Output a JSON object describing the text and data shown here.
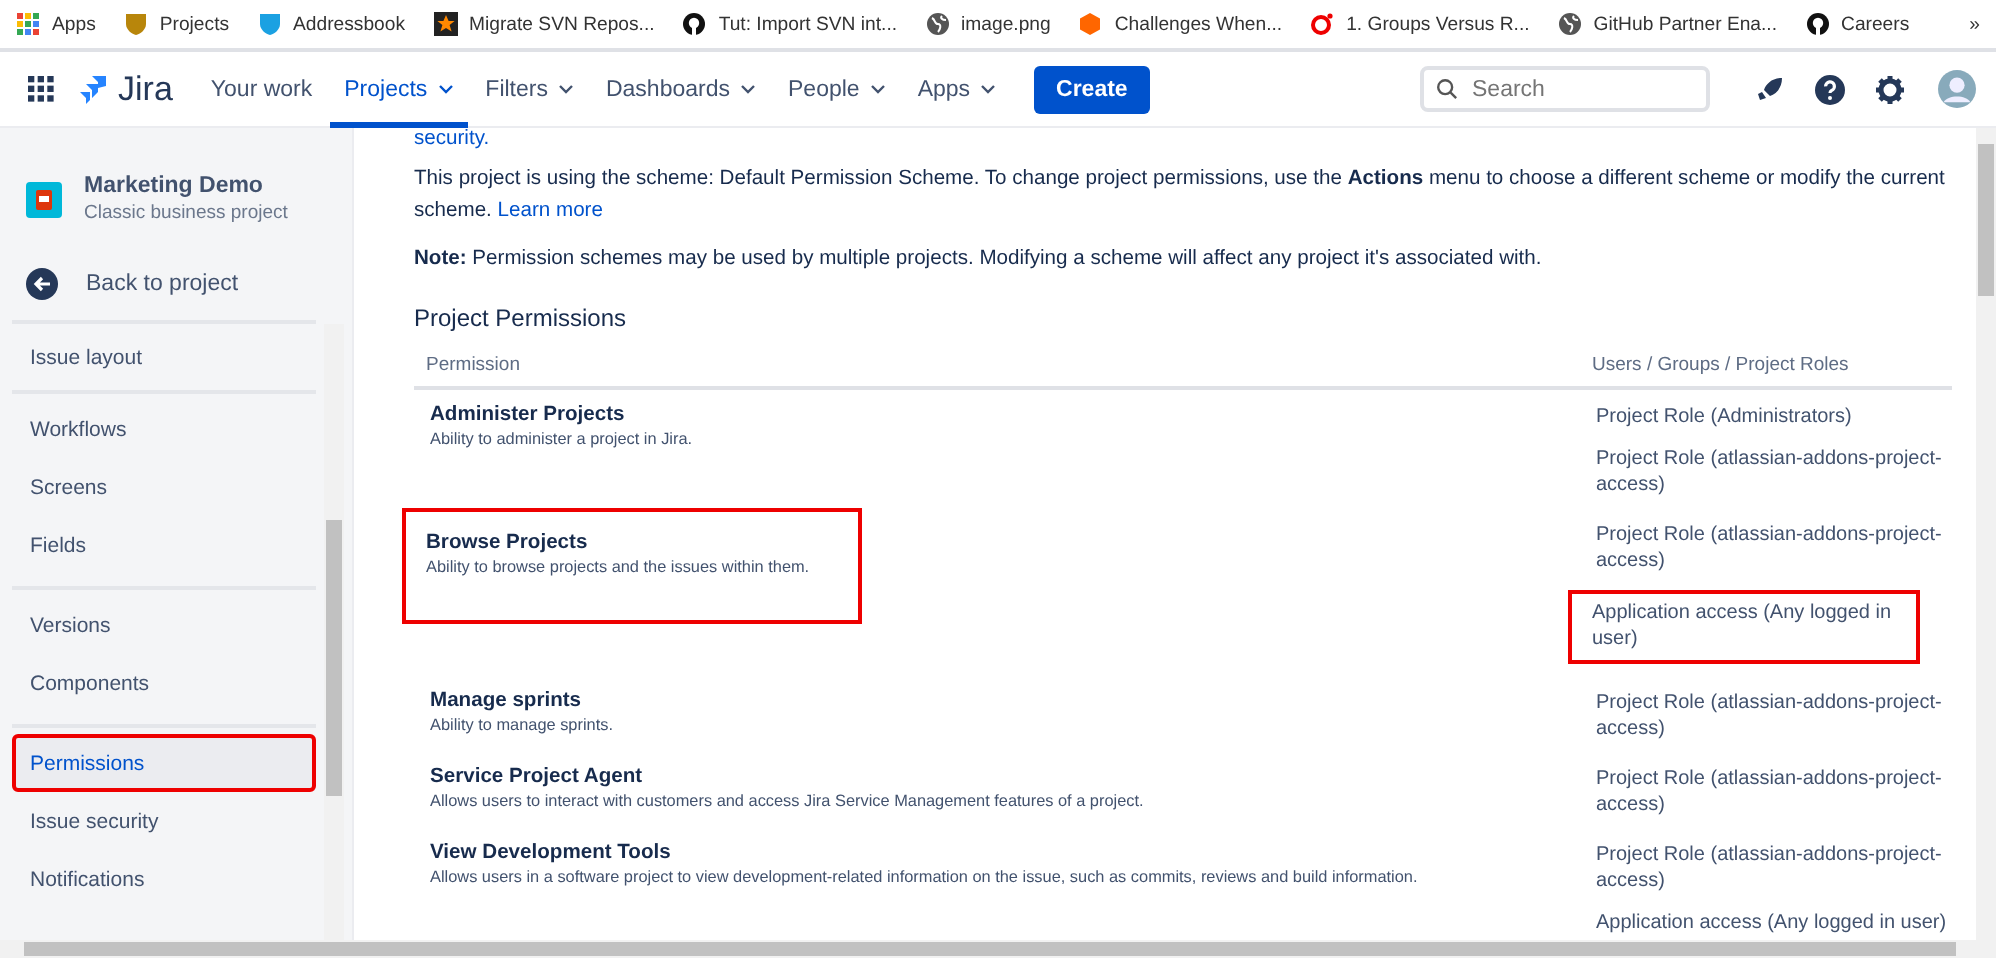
{
  "bookmarks": [
    "Apps",
    "Projects",
    "Addressbook",
    "Migrate SVN Repos...",
    "Tut: Import SVN int...",
    "image.png",
    "Challenges When...",
    "1. Groups Versus R...",
    "GitHub Partner Ena...",
    "Careers"
  ],
  "bookmarks_more": "»",
  "nav": {
    "logo": "Jira",
    "items": [
      {
        "label": "Your work",
        "dropdown": false,
        "selected": false
      },
      {
        "label": "Projects",
        "dropdown": true,
        "selected": true
      },
      {
        "label": "Filters",
        "dropdown": true,
        "selected": false
      },
      {
        "label": "Dashboards",
        "dropdown": true,
        "selected": false
      },
      {
        "label": "People",
        "dropdown": true,
        "selected": false
      },
      {
        "label": "Apps",
        "dropdown": true,
        "selected": false
      }
    ],
    "create": "Create",
    "search": {
      "placeholder": "Search"
    }
  },
  "sidebar": {
    "project": {
      "name": "Marketing Demo",
      "type": "Classic business project"
    },
    "back": "Back to project",
    "sections": [
      {
        "items": [
          {
            "label": "Issue layout",
            "selected": false,
            "highlighted": false
          }
        ]
      },
      {
        "items": [
          {
            "label": "Workflows",
            "selected": false,
            "highlighted": false
          },
          {
            "label": "Screens",
            "selected": false,
            "highlighted": false
          },
          {
            "label": "Fields",
            "selected": false,
            "highlighted": false
          }
        ]
      },
      {
        "items": [
          {
            "label": "Versions",
            "selected": false,
            "highlighted": false
          },
          {
            "label": "Components",
            "selected": false,
            "highlighted": false
          }
        ]
      },
      {
        "items": [
          {
            "label": "Permissions",
            "selected": true,
            "highlighted": true
          },
          {
            "label": "Issue security",
            "selected": false,
            "highlighted": false
          },
          {
            "label": "Notifications",
            "selected": false,
            "highlighted": false
          }
        ]
      }
    ]
  },
  "content": {
    "top_link": "security.",
    "intro": "This project is using the scheme: Default Permission Scheme. To change project permissions, use the **Actions** menu to choose a different scheme or modify the current scheme.",
    "learn_more": "Learn more",
    "note": "**Note:** Permission schemes may be used by multiple projects. Modifying a scheme will affect any project it's associated with.",
    "heading": "Project Permissions",
    "table": {
      "columns": [
        "Permission",
        "Users / Groups / Project Roles"
      ],
      "rows": [
        {
          "name": "Administer Projects",
          "description": "Ability to administer a project in Jira.",
          "highlighted": false,
          "grantees": [
            {
              "text": "Project Role (Administrators)",
              "highlighted": false
            },
            {
              "text": "Project Role (atlassian-addons-project-access)",
              "highlighted": false
            }
          ]
        },
        {
          "name": "Browse Projects",
          "description": "Ability to browse projects and the issues within them.",
          "highlighted": true,
          "grantees": [
            {
              "text": "Project Role (atlassian-addons-project-access)",
              "highlighted": false
            },
            {
              "text": "Application access (Any logged in user)",
              "highlighted": true
            }
          ]
        },
        {
          "name": "Manage sprints",
          "description": "Ability to manage sprints.",
          "highlighted": false,
          "grantees": [
            {
              "text": "Project Role (atlassian-addons-project-access)",
              "highlighted": false
            }
          ]
        },
        {
          "name": "Service Project Agent",
          "description": "Allows users to interact with customers and access Jira Service Management features of a project.",
          "highlighted": false,
          "grantees": [
            {
              "text": "Project Role (atlassian-addons-project-access)",
              "highlighted": false
            }
          ]
        },
        {
          "name": "View Development Tools",
          "description": "Allows users in a software project to view development-related information on the issue, such as commits, reviews and build information.",
          "highlighted": false,
          "grantees": [
            {
              "text": "Project Role (atlassian-addons-project-access)",
              "highlighted": false
            },
            {
              "text": "Application access (Any logged in user)",
              "highlighted": false
            }
          ]
        }
      ]
    }
  }
}
